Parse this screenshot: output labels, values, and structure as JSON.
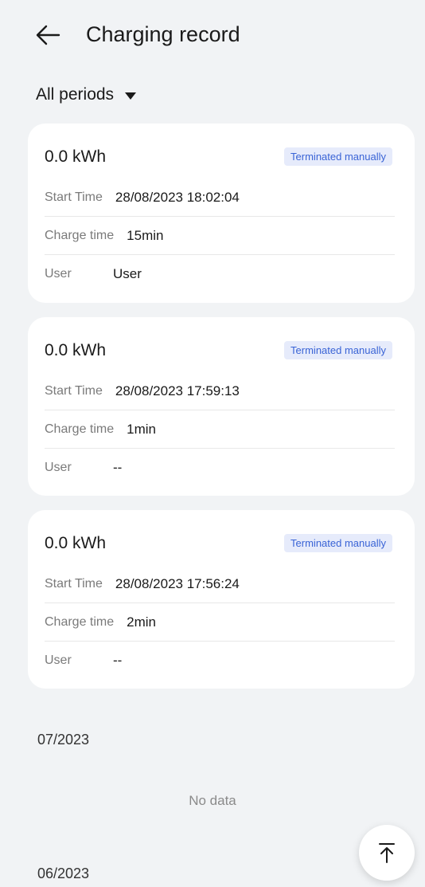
{
  "header": {
    "title": "Charging record"
  },
  "filter": {
    "period_label": "All periods"
  },
  "records": [
    {
      "energy": "0.0 kWh",
      "status": "Terminated manually",
      "start_label": "Start Time",
      "start_value": "28/08/2023 18:02:04",
      "charge_label": "Charge time",
      "charge_value": "15min",
      "user_label": "User",
      "user_value": "User"
    },
    {
      "energy": "0.0 kWh",
      "status": "Terminated manually",
      "start_label": "Start Time",
      "start_value": "28/08/2023 17:59:13",
      "charge_label": "Charge time",
      "charge_value": "1min",
      "user_label": "User",
      "user_value": "--"
    },
    {
      "energy": "0.0 kWh",
      "status": "Terminated manually",
      "start_label": "Start Time",
      "start_value": "28/08/2023 17:56:24",
      "charge_label": "Charge time",
      "charge_value": "2min",
      "user_label": "User",
      "user_value": "--"
    }
  ],
  "months": [
    {
      "label": "07/2023",
      "empty_text": "No data"
    },
    {
      "label": "06/2023"
    }
  ],
  "icons": {
    "back": "arrow-left-icon",
    "period_caret": "caret-down-icon",
    "scroll_top": "arrow-up-to-top-icon"
  },
  "colors": {
    "background": "#f1f3f5",
    "card": "#ffffff",
    "badge_bg": "#e6ebfb",
    "badge_text": "#3a64d6"
  }
}
